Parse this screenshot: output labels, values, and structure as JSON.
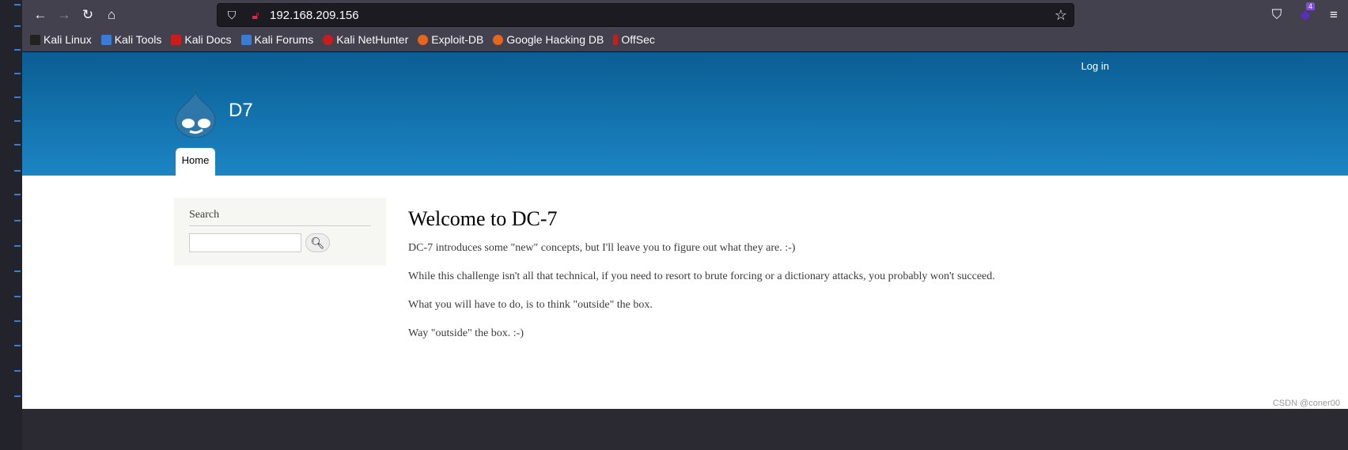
{
  "browser": {
    "url": "192.168.209.156",
    "extension_badge": "4",
    "bookmarks": [
      {
        "label": "Kali Linux",
        "color": "#222222"
      },
      {
        "label": "Kali Tools",
        "color": "#3a7bd5"
      },
      {
        "label": "Kali Docs",
        "color": "#c91d1d"
      },
      {
        "label": "Kali Forums",
        "color": "#3a7bd5"
      },
      {
        "label": "Kali NetHunter",
        "color": "#c91d1d"
      },
      {
        "label": "Exploit-DB",
        "color": "#e8661c"
      },
      {
        "label": "Google Hacking DB",
        "color": "#e8661c"
      },
      {
        "label": "OffSec",
        "color": "#c91d1d"
      }
    ]
  },
  "site": {
    "login": "Log in",
    "name": "D7",
    "tab_home": "Home",
    "search_title": "Search",
    "search_value": "",
    "heading": "Welcome to DC-7",
    "paragraphs": [
      "DC-7 introduces some \"new\" concepts, but I'll leave you to figure out what they are.  :-)",
      "While this challenge isn't all that technical, if you need to resort to brute forcing or a dictionary attacks, you probably won't succeed.",
      "What you will have to do, is to think \"outside\" the box.",
      "Way \"outside\" the box.  :-)"
    ]
  },
  "watermark": "CSDN @coner00"
}
